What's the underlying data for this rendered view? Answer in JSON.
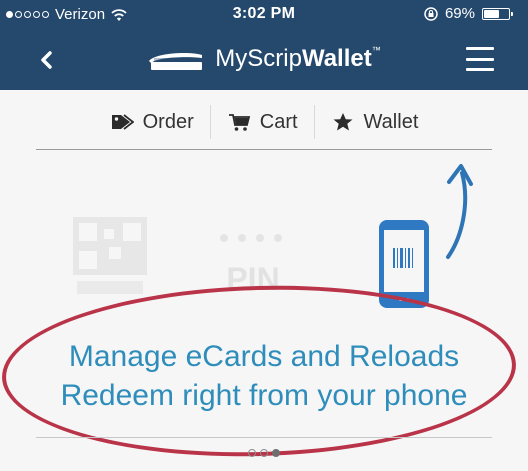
{
  "status_bar": {
    "carrier": "Verizon",
    "time": "3:02 PM",
    "battery": "69%",
    "battery_level": 0.69,
    "signal_dots_filled": 1,
    "signal_dots_total": 5
  },
  "header": {
    "brand_light": "MyScrip",
    "brand_bold": "Wallet",
    "brand_mark": "™",
    "background": "#25496c"
  },
  "tabs": [
    {
      "label": "Order",
      "icon": "tag-icon"
    },
    {
      "label": "Cart",
      "icon": "cart-icon"
    },
    {
      "label": "Wallet",
      "icon": "star-icon"
    }
  ],
  "illustration": {
    "pin_label": "PIN",
    "phone_icon": "phone-barcode-icon",
    "qr_icon": "qr-card-icon"
  },
  "feature": {
    "line1": "Manage eCards and Reloads",
    "line2": "Redeem right from your phone"
  },
  "pager": {
    "count": 3,
    "active_index": 2
  },
  "colors": {
    "accent": "#2e8dbb",
    "annotation": "#b93448",
    "arrow": "#2f75b6"
  }
}
